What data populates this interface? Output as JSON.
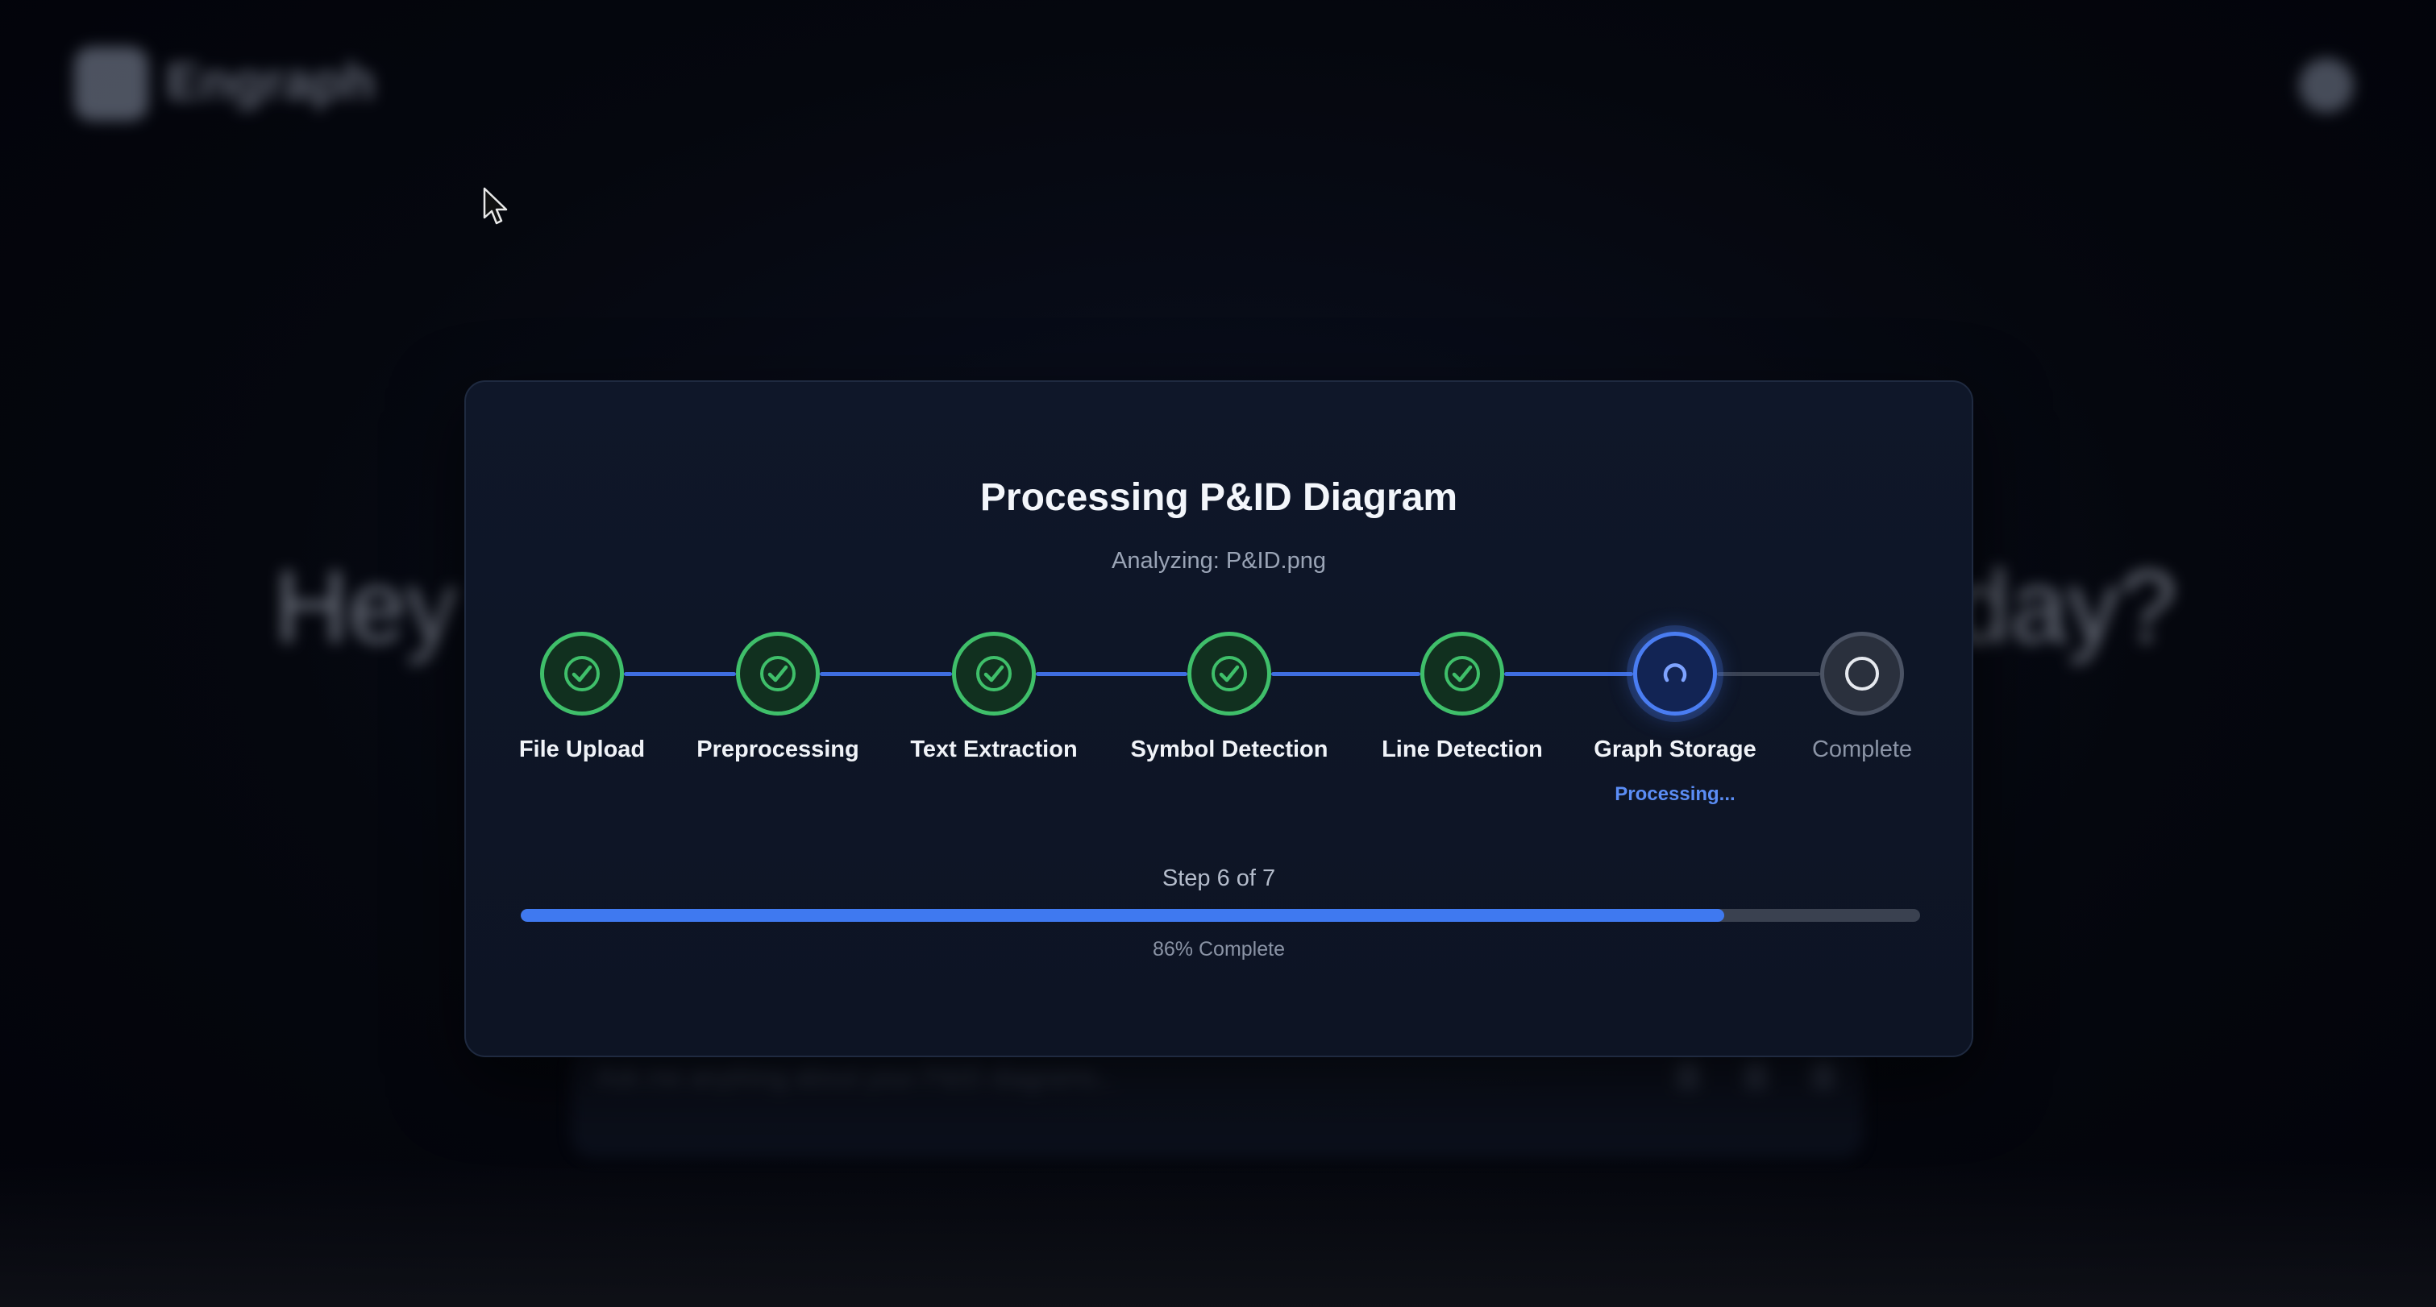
{
  "app": {
    "brand": "Engraph"
  },
  "background": {
    "hero_left": "Hey t",
    "hero_right": "day?",
    "input_placeholder": "Ask me anything about your P&ID diagrams..."
  },
  "modal": {
    "title": "Processing P&ID Diagram",
    "subtitle": "Analyzing: P&ID.png",
    "steps": [
      {
        "label": "File Upload",
        "state": "done",
        "icon": "check-circle-icon"
      },
      {
        "label": "Preprocessing",
        "state": "done",
        "icon": "check-circle-icon"
      },
      {
        "label": "Text Extraction",
        "state": "done",
        "icon": "check-circle-icon"
      },
      {
        "label": "Symbol Detection",
        "state": "done",
        "icon": "check-circle-icon"
      },
      {
        "label": "Line Detection",
        "state": "done",
        "icon": "check-circle-icon"
      },
      {
        "label": "Graph Storage",
        "state": "active",
        "icon": "spinner-icon",
        "status": "Processing..."
      },
      {
        "label": "Complete",
        "state": "pending",
        "icon": "circle-icon"
      }
    ],
    "step_counter": "Step 6 of 7",
    "progress_fraction": 0.86,
    "progress_text": "86% Complete"
  },
  "colors": {
    "done": "#3fbf6a",
    "active": "#4a7df2",
    "pending": "#4b5364",
    "progress": "#3f79f0"
  }
}
